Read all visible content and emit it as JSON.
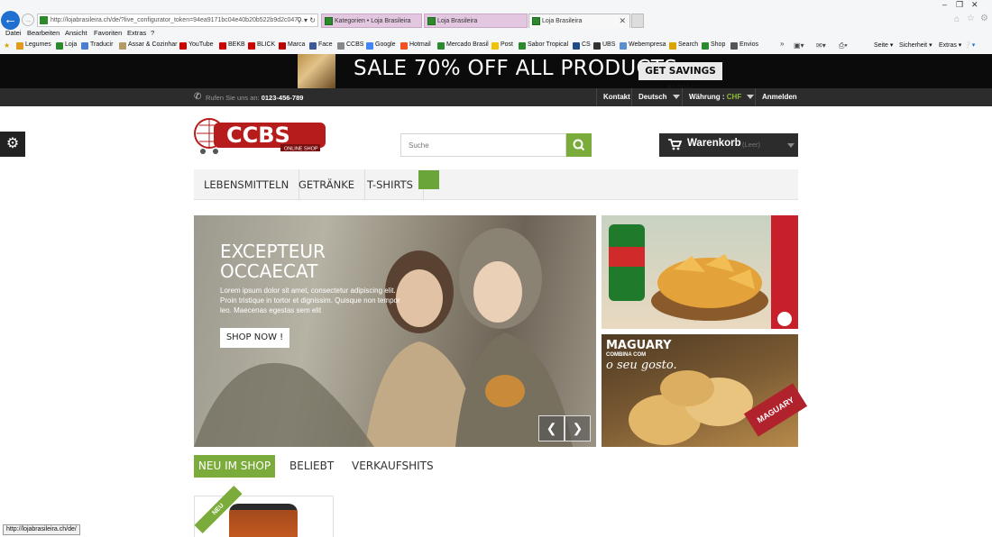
{
  "browser": {
    "address": "http://lojabrasileira.ch/de/?live_configurator_token=94ea9171bc04e40b20b522b9d2c047...",
    "tabs": [
      "Kategorien • Loja Brasileira",
      "Loja Brasileira",
      "Loja Brasileira"
    ],
    "menu": [
      "Datei",
      "Bearbeiten",
      "Ansicht",
      "Favoriten",
      "Extras",
      "?"
    ],
    "favorites": [
      "Legumes",
      "Loja",
      "Traducir",
      "Assar & Cozinhar",
      "YouTube",
      "BEKB",
      "BLICK",
      "Marca",
      "Face",
      "CCBS",
      "Google",
      "Hotmail",
      "Mercado Brasil",
      "Post",
      "Sabor Tropical",
      "CS",
      "UBS",
      "Webempresa",
      "Search",
      "Shop",
      "Envios"
    ],
    "toolbar": [
      "Seite",
      "Sicherheit",
      "Extras"
    ],
    "status_url": "http://lojabrasileira.ch/de/"
  },
  "promo": {
    "text": "SALE 70% OFF ALL PRODUCTS",
    "button": "GET SAVINGS NOW"
  },
  "topnav": {
    "call_label": "Rufen Sie uns an:",
    "phone": "0123-456-789",
    "contact": "Kontakt",
    "language": "Deutsch",
    "currency_label": "Währung :",
    "currency_value": "CHF",
    "login": "Anmelden"
  },
  "logo": {
    "text": "CCBS",
    "sub": "ONLINE SHOP"
  },
  "search": {
    "placeholder": "Suche"
  },
  "cart": {
    "label": "Warenkorb",
    "status": "(Leer)"
  },
  "mainnav": [
    "LEBENSMITTELN",
    "GETRÄNKE",
    "T-SHIRTS"
  ],
  "slider": {
    "title_line1": "EXCEPTEUR",
    "title_line2": "OCCAECAT",
    "text": "Lorem ipsum dolor sit amet, consectetur adipiscing elit. Proin tristique in tortor et dignissim. Quisque non tempor leo. Maecenas egestas sem elit",
    "button": "SHOP NOW !"
  },
  "banner2": {
    "line1": "MAGUARY",
    "line2": "COMBINA COM",
    "line3": "o seu gosto.",
    "brand": "MAGUARY"
  },
  "product_tabs": [
    "NEU IM SHOP",
    "BELIEBT",
    "VERKAUFSHITS"
  ],
  "product": {
    "ribbon": "NEU"
  },
  "colors": {
    "accent": "#7bab3a",
    "dark": "#2c2c2c",
    "promo_bg": "#0b0b0b"
  }
}
